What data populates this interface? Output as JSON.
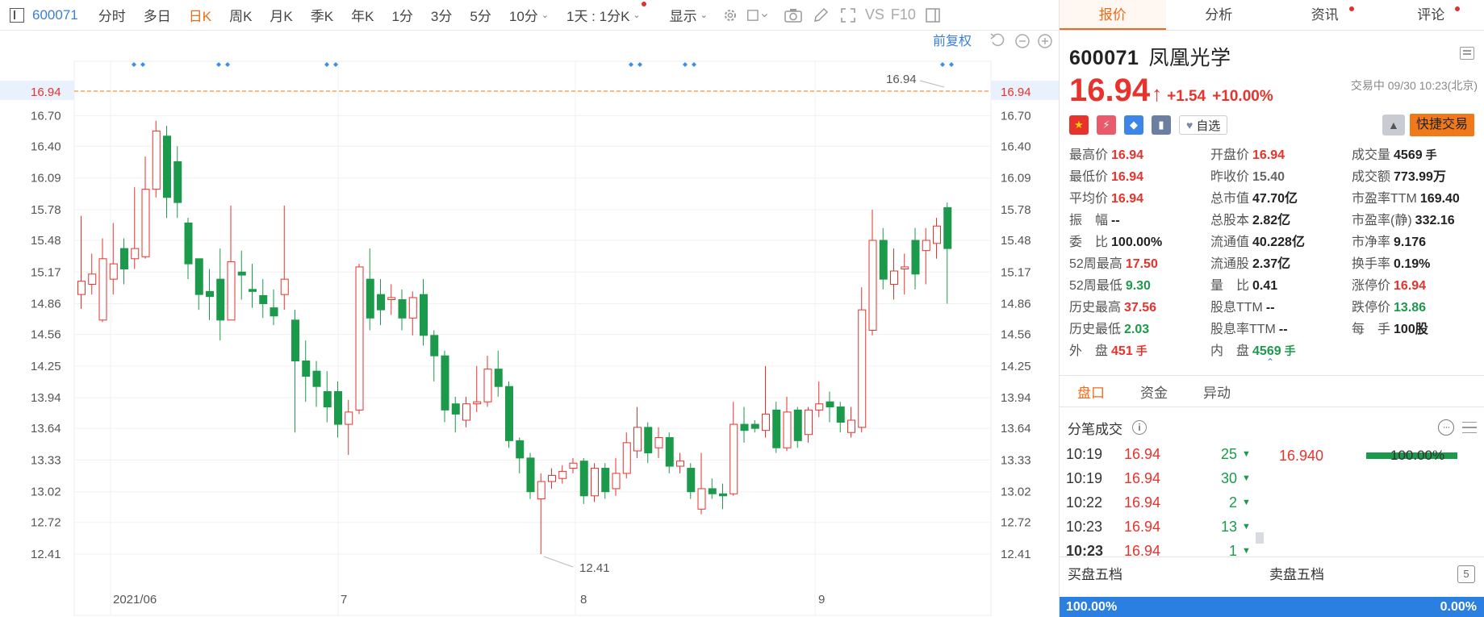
{
  "toolbar": {
    "code": "600071",
    "periods": [
      "分时",
      "多日",
      "日K",
      "周K",
      "月K",
      "季K",
      "年K",
      "1分",
      "3分",
      "5分",
      "10分"
    ],
    "active_period": "日K",
    "interval_select": "1天 : 1分K",
    "display_label": "显示",
    "vs_label": "VS",
    "f10_label": "F10"
  },
  "chart": {
    "restore_label": "前复权",
    "current_price_tag": "16.94",
    "last_price_label": "16.94",
    "min_price_label": "12.41",
    "y_labels": [
      "16.70",
      "16.40",
      "16.09",
      "15.78",
      "15.48",
      "15.17",
      "14.86",
      "14.56",
      "14.25",
      "13.94",
      "13.64",
      "13.33",
      "13.02",
      "12.72",
      "12.41"
    ],
    "x_labels": [
      "2021/06",
      "7",
      "8",
      "9"
    ]
  },
  "chart_data": {
    "type": "candlestick",
    "y_range": [
      12.1,
      17.0
    ],
    "candles": [
      {
        "o": 14.95,
        "c": 15.08,
        "h": 15.72,
        "l": 14.81
      },
      {
        "o": 15.05,
        "c": 15.15,
        "h": 15.35,
        "l": 14.95
      },
      {
        "o": 14.7,
        "c": 15.3,
        "h": 15.5,
        "l": 14.68
      },
      {
        "o": 15.1,
        "c": 15.25,
        "h": 15.65,
        "l": 14.95
      },
      {
        "o": 15.4,
        "c": 15.2,
        "h": 15.5,
        "l": 15.05
      },
      {
        "o": 15.3,
        "c": 15.4,
        "h": 16.0,
        "l": 15.2
      },
      {
        "o": 15.32,
        "c": 15.98,
        "h": 16.3,
        "l": 15.3
      },
      {
        "o": 15.98,
        "c": 16.55,
        "h": 16.65,
        "l": 15.9
      },
      {
        "o": 16.5,
        "c": 15.9,
        "h": 16.6,
        "l": 15.7
      },
      {
        "o": 16.25,
        "c": 15.85,
        "h": 16.4,
        "l": 15.7
      },
      {
        "o": 15.65,
        "c": 15.25,
        "h": 15.7,
        "l": 15.1
      },
      {
        "o": 15.3,
        "c": 14.95,
        "h": 15.3,
        "l": 14.8
      },
      {
        "o": 14.98,
        "c": 14.93,
        "h": 15.2,
        "l": 14.7
      },
      {
        "o": 15.1,
        "c": 14.7,
        "h": 15.4,
        "l": 14.5
      },
      {
        "o": 14.7,
        "c": 15.27,
        "h": 15.82,
        "l": 14.7
      },
      {
        "o": 15.17,
        "c": 15.14,
        "h": 15.38,
        "l": 14.9
      },
      {
        "o": 15.0,
        "c": 14.98,
        "h": 15.25,
        "l": 14.82
      },
      {
        "o": 14.94,
        "c": 14.86,
        "h": 15.1,
        "l": 14.72
      },
      {
        "o": 14.82,
        "c": 14.74,
        "h": 15.0,
        "l": 14.65
      },
      {
        "o": 14.95,
        "c": 15.1,
        "h": 15.82,
        "l": 14.8
      },
      {
        "o": 14.7,
        "c": 14.3,
        "h": 14.8,
        "l": 13.6
      },
      {
        "o": 14.3,
        "c": 14.15,
        "h": 14.5,
        "l": 13.9
      },
      {
        "o": 14.2,
        "c": 14.05,
        "h": 14.3,
        "l": 13.85
      },
      {
        "o": 14.0,
        "c": 13.85,
        "h": 14.2,
        "l": 13.7
      },
      {
        "o": 14.0,
        "c": 13.68,
        "h": 14.1,
        "l": 13.55
      },
      {
        "o": 13.68,
        "c": 13.8,
        "h": 13.92,
        "l": 13.38
      },
      {
        "o": 13.82,
        "c": 15.22,
        "h": 15.25,
        "l": 13.78
      },
      {
        "o": 15.1,
        "c": 14.72,
        "h": 15.4,
        "l": 14.6
      },
      {
        "o": 14.95,
        "c": 14.8,
        "h": 15.1,
        "l": 14.65
      },
      {
        "o": 14.9,
        "c": 14.92,
        "h": 15.05,
        "l": 14.75
      },
      {
        "o": 14.9,
        "c": 14.72,
        "h": 15.0,
        "l": 14.6
      },
      {
        "o": 14.72,
        "c": 14.92,
        "h": 14.98,
        "l": 14.55
      },
      {
        "o": 14.95,
        "c": 14.55,
        "h": 15.1,
        "l": 14.45
      },
      {
        "o": 14.55,
        "c": 14.35,
        "h": 14.6,
        "l": 14.1
      },
      {
        "o": 14.35,
        "c": 13.82,
        "h": 14.4,
        "l": 13.7
      },
      {
        "o": 13.88,
        "c": 13.78,
        "h": 13.95,
        "l": 13.6
      },
      {
        "o": 13.72,
        "c": 13.88,
        "h": 13.95,
        "l": 13.65
      },
      {
        "o": 13.88,
        "c": 13.9,
        "h": 14.25,
        "l": 13.8
      },
      {
        "o": 13.9,
        "c": 14.22,
        "h": 14.35,
        "l": 13.85
      },
      {
        "o": 14.22,
        "c": 14.05,
        "h": 14.4,
        "l": 13.95
      },
      {
        "o": 14.05,
        "c": 13.52,
        "h": 14.1,
        "l": 13.45
      },
      {
        "o": 13.52,
        "c": 13.35,
        "h": 13.55,
        "l": 13.2
      },
      {
        "o": 13.35,
        "c": 13.02,
        "h": 13.4,
        "l": 12.95
      },
      {
        "o": 12.95,
        "c": 13.12,
        "h": 13.2,
        "l": 12.41
      },
      {
        "o": 13.12,
        "c": 13.18,
        "h": 13.25,
        "l": 13.05
      },
      {
        "o": 13.15,
        "c": 13.22,
        "h": 13.28,
        "l": 13.1
      },
      {
        "o": 13.25,
        "c": 13.3,
        "h": 13.35,
        "l": 13.2
      },
      {
        "o": 13.32,
        "c": 12.98,
        "h": 13.35,
        "l": 12.9
      },
      {
        "o": 12.98,
        "c": 13.25,
        "h": 13.3,
        "l": 12.92
      },
      {
        "o": 13.25,
        "c": 13.02,
        "h": 13.3,
        "l": 12.95
      },
      {
        "o": 13.05,
        "c": 13.2,
        "h": 13.35,
        "l": 12.98
      },
      {
        "o": 13.2,
        "c": 13.5,
        "h": 13.6,
        "l": 13.15
      },
      {
        "o": 13.42,
        "c": 13.65,
        "h": 13.85,
        "l": 13.35
      },
      {
        "o": 13.65,
        "c": 13.4,
        "h": 13.7,
        "l": 13.3
      },
      {
        "o": 13.45,
        "c": 13.55,
        "h": 13.65,
        "l": 13.35
      },
      {
        "o": 13.55,
        "c": 13.27,
        "h": 13.6,
        "l": 13.2
      },
      {
        "o": 13.27,
        "c": 13.32,
        "h": 13.4,
        "l": 13.2
      },
      {
        "o": 13.25,
        "c": 13.02,
        "h": 13.3,
        "l": 12.95
      },
      {
        "o": 12.85,
        "c": 13.05,
        "h": 13.4,
        "l": 12.8
      },
      {
        "o": 13.05,
        "c": 13.0,
        "h": 13.15,
        "l": 12.95
      },
      {
        "o": 13.0,
        "c": 12.98,
        "h": 13.1,
        "l": 12.85
      },
      {
        "o": 13.0,
        "c": 13.68,
        "h": 13.9,
        "l": 12.98
      },
      {
        "o": 13.68,
        "c": 13.62,
        "h": 13.85,
        "l": 13.5
      },
      {
        "o": 13.68,
        "c": 13.64,
        "h": 13.72,
        "l": 13.6
      },
      {
        "o": 13.62,
        "c": 13.78,
        "h": 14.25,
        "l": 13.55
      },
      {
        "o": 13.82,
        "c": 13.45,
        "h": 13.9,
        "l": 13.4
      },
      {
        "o": 13.45,
        "c": 13.8,
        "h": 13.95,
        "l": 13.42
      },
      {
        "o": 13.82,
        "c": 13.52,
        "h": 13.85,
        "l": 13.45
      },
      {
        "o": 13.58,
        "c": 13.82,
        "h": 13.85,
        "l": 13.5
      },
      {
        "o": 13.82,
        "c": 13.88,
        "h": 14.1,
        "l": 13.75
      },
      {
        "o": 13.9,
        "c": 13.85,
        "h": 14.0,
        "l": 13.7
      },
      {
        "o": 13.85,
        "c": 13.7,
        "h": 13.9,
        "l": 13.6
      },
      {
        "o": 13.6,
        "c": 13.72,
        "h": 13.85,
        "l": 13.55
      },
      {
        "o": 13.65,
        "c": 14.8,
        "h": 15.02,
        "l": 13.6
      },
      {
        "o": 14.6,
        "c": 15.48,
        "h": 15.78,
        "l": 14.55
      },
      {
        "o": 15.48,
        "c": 15.1,
        "h": 15.6,
        "l": 15.0
      },
      {
        "o": 15.05,
        "c": 15.18,
        "h": 15.4,
        "l": 14.9
      },
      {
        "o": 15.2,
        "c": 15.22,
        "h": 15.35,
        "l": 14.95
      },
      {
        "o": 15.48,
        "c": 15.15,
        "h": 15.6,
        "l": 15.0
      },
      {
        "o": 15.38,
        "c": 15.48,
        "h": 15.6,
        "l": 15.05
      },
      {
        "o": 15.45,
        "c": 15.62,
        "h": 15.7,
        "l": 15.3
      },
      {
        "o": 15.8,
        "c": 15.4,
        "h": 15.85,
        "l": 14.86
      }
    ]
  },
  "tabs": [
    "报价",
    "分析",
    "资讯",
    "评论"
  ],
  "stock": {
    "code": "600071",
    "name": "凤凰光学",
    "price": "16.94",
    "change": "+1.54",
    "change_pct": "+10.00%",
    "trade_time": "交易中 09/30 10:23(北京)",
    "fav_label": "自选",
    "fast_trade_label": "快捷交易"
  },
  "stats": [
    {
      "label": "最高价",
      "value": "16.94",
      "color": "red"
    },
    {
      "label": "开盘价",
      "value": "16.94",
      "color": "red"
    },
    {
      "label": "成交量",
      "value": "4569",
      "unit": "手",
      "color": "dark"
    },
    {
      "label": "最低价",
      "value": "16.94",
      "color": "red"
    },
    {
      "label": "昨收价",
      "value": "15.40",
      "color": "gray"
    },
    {
      "label": "成交额",
      "value": "773.99万",
      "color": "dark"
    },
    {
      "label": "平均价",
      "value": "16.94",
      "color": "red"
    },
    {
      "label": "总市值",
      "value": "47.70亿",
      "color": "dark"
    },
    {
      "label": "市盈率TTM",
      "value": "169.40",
      "color": "dark"
    },
    {
      "label": "振　幅",
      "value": "--",
      "color": "dark"
    },
    {
      "label": "总股本",
      "value": "2.82亿",
      "color": "dark"
    },
    {
      "label": "市盈率(静)",
      "value": "332.16",
      "color": "dark"
    },
    {
      "label": "委　比",
      "value": "100.00%",
      "color": "dark"
    },
    {
      "label": "流通值",
      "value": "40.228亿",
      "color": "dark"
    },
    {
      "label": "市净率",
      "value": "9.176",
      "color": "dark"
    },
    {
      "label": "52周最高",
      "value": "17.50",
      "color": "red"
    },
    {
      "label": "流通股",
      "value": "2.37亿",
      "color": "dark"
    },
    {
      "label": "换手率",
      "value": "0.19%",
      "color": "dark"
    },
    {
      "label": "52周最低",
      "value": "9.30",
      "color": "green"
    },
    {
      "label": "量　比",
      "value": "0.41",
      "color": "dark"
    },
    {
      "label": "涨停价",
      "value": "16.94",
      "color": "red"
    },
    {
      "label": "历史最高",
      "value": "37.56",
      "color": "red"
    },
    {
      "label": "股息TTM",
      "value": "--",
      "color": "dark"
    },
    {
      "label": "跌停价",
      "value": "13.86",
      "color": "green"
    },
    {
      "label": "历史最低",
      "value": "2.03",
      "color": "green"
    },
    {
      "label": "股息率TTM",
      "value": "--",
      "color": "dark"
    },
    {
      "label": "每　手",
      "value": "100股",
      "color": "dark"
    },
    {
      "label": "外　盘",
      "value": "451",
      "unit": "手",
      "color": "red"
    },
    {
      "label": "内　盘",
      "value": "4569",
      "unit": "手",
      "color": "green"
    }
  ],
  "sub_tabs": [
    "盘口",
    "资金",
    "异动"
  ],
  "ticks_title": "分笔成交",
  "ticks": [
    {
      "time": "10:19",
      "price": "16.94",
      "vol": "25"
    },
    {
      "time": "10:19",
      "price": "16.94",
      "vol": "30"
    },
    {
      "time": "10:22",
      "price": "16.94",
      "vol": "2"
    },
    {
      "time": "10:23",
      "price": "16.94",
      "vol": "13"
    },
    {
      "time": "10:23",
      "price": "16.94",
      "vol": "1"
    }
  ],
  "price_dist": {
    "price": "16.940",
    "pct": "100.00%"
  },
  "book": {
    "buy_label": "买盘五档",
    "sell_label": "卖盘五档",
    "buy_pct": "100.00%",
    "sell_pct": "0.00%"
  },
  "colors": {
    "up": "#e8322c",
    "down": "#1a9a4a",
    "accent": "#f06a17",
    "blue": "#2a7fe0"
  }
}
